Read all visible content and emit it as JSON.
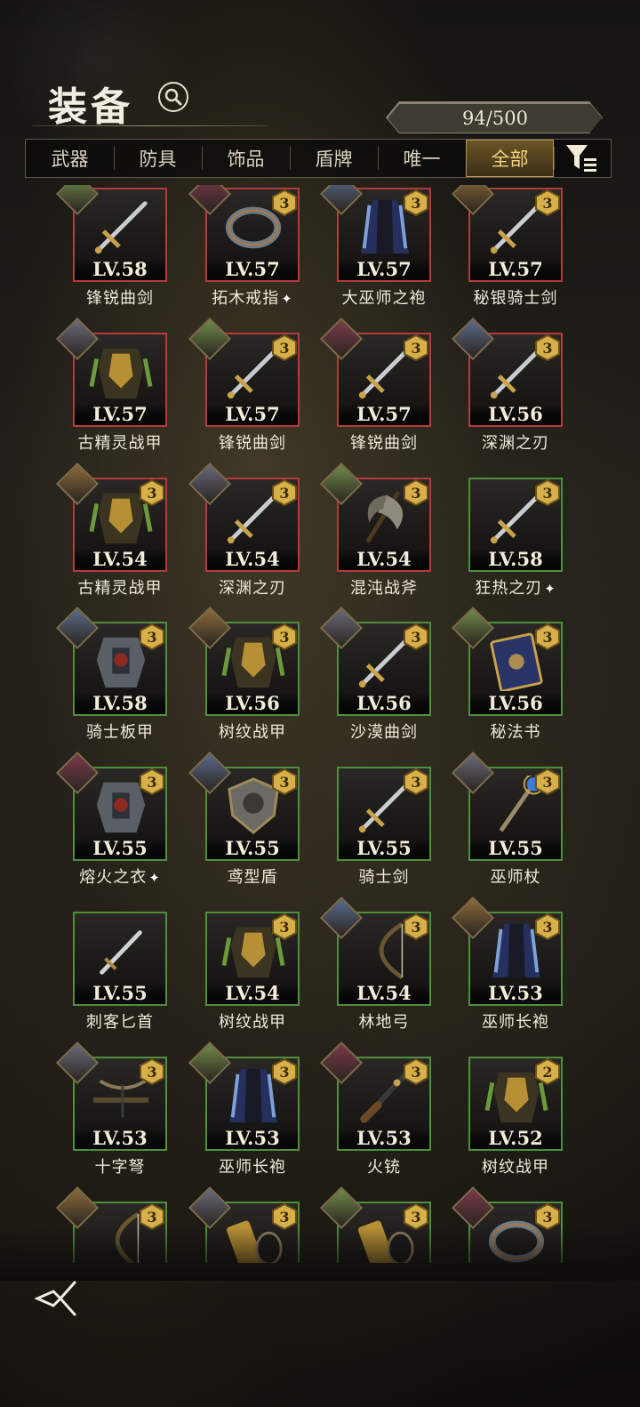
{
  "header": {
    "title": "装备",
    "capacity": "94/500"
  },
  "icons": {
    "search": "search-icon",
    "filter": "filter-icon",
    "back": "back-icon",
    "new_item": "sparkle-icon"
  },
  "tabs": [
    {
      "label": "武器",
      "active": false
    },
    {
      "label": "防具",
      "active": false
    },
    {
      "label": "饰品",
      "active": false
    },
    {
      "label": "盾牌",
      "active": false
    },
    {
      "label": "唯一",
      "active": false
    },
    {
      "label": "全部",
      "active": true
    }
  ],
  "items": [
    {
      "name": "锋锐曲剑",
      "level": "LV.58",
      "rarity": "red",
      "badge": "",
      "has_portrait": true,
      "new": false,
      "art": "sword"
    },
    {
      "name": "拓木戒指",
      "level": "LV.57",
      "rarity": "red",
      "badge": "3",
      "has_portrait": true,
      "new": true,
      "art": "ring"
    },
    {
      "name": "大巫师之袍",
      "level": "LV.57",
      "rarity": "red",
      "badge": "3",
      "has_portrait": true,
      "new": false,
      "art": "robe"
    },
    {
      "name": "秘银骑士剑",
      "level": "LV.57",
      "rarity": "red",
      "badge": "3",
      "has_portrait": true,
      "new": false,
      "art": "sword"
    },
    {
      "name": "古精灵战甲",
      "level": "LV.57",
      "rarity": "red",
      "badge": "",
      "has_portrait": true,
      "new": false,
      "art": "armor"
    },
    {
      "name": "锋锐曲剑",
      "level": "LV.57",
      "rarity": "red",
      "badge": "3",
      "has_portrait": true,
      "new": false,
      "art": "sword"
    },
    {
      "name": "锋锐曲剑",
      "level": "LV.57",
      "rarity": "red",
      "badge": "3",
      "has_portrait": true,
      "new": false,
      "art": "sword"
    },
    {
      "name": "深渊之刃",
      "level": "LV.56",
      "rarity": "red",
      "badge": "3",
      "has_portrait": true,
      "new": false,
      "art": "sword"
    },
    {
      "name": "古精灵战甲",
      "level": "LV.54",
      "rarity": "red",
      "badge": "3",
      "has_portrait": true,
      "new": false,
      "art": "armor"
    },
    {
      "name": "深渊之刃",
      "level": "LV.54",
      "rarity": "red",
      "badge": "3",
      "has_portrait": true,
      "new": false,
      "art": "sword"
    },
    {
      "name": "混沌战斧",
      "level": "LV.54",
      "rarity": "red",
      "badge": "3",
      "has_portrait": true,
      "new": false,
      "art": "axe"
    },
    {
      "name": "狂热之刃",
      "level": "LV.58",
      "rarity": "green",
      "badge": "3",
      "has_portrait": false,
      "new": true,
      "art": "sword"
    },
    {
      "name": "骑士板甲",
      "level": "LV.58",
      "rarity": "green",
      "badge": "3",
      "has_portrait": true,
      "new": false,
      "art": "plate"
    },
    {
      "name": "树纹战甲",
      "level": "LV.56",
      "rarity": "green",
      "badge": "3",
      "has_portrait": true,
      "new": false,
      "art": "armor"
    },
    {
      "name": "沙漠曲剑",
      "level": "LV.56",
      "rarity": "green",
      "badge": "3",
      "has_portrait": true,
      "new": false,
      "art": "sword"
    },
    {
      "name": "秘法书",
      "level": "LV.56",
      "rarity": "green",
      "badge": "3",
      "has_portrait": true,
      "new": false,
      "art": "book"
    },
    {
      "name": "熔火之衣",
      "level": "LV.55",
      "rarity": "green",
      "badge": "3",
      "has_portrait": true,
      "new": true,
      "art": "plate"
    },
    {
      "name": "鸢型盾",
      "level": "LV.55",
      "rarity": "green",
      "badge": "3",
      "has_portrait": true,
      "new": false,
      "art": "shield"
    },
    {
      "name": "骑士剑",
      "level": "LV.55",
      "rarity": "green",
      "badge": "3",
      "has_portrait": false,
      "new": false,
      "art": "sword"
    },
    {
      "name": "巫师杖",
      "level": "LV.55",
      "rarity": "green",
      "badge": "3",
      "has_portrait": true,
      "new": false,
      "art": "staff"
    },
    {
      "name": "刺客匕首",
      "level": "LV.55",
      "rarity": "green",
      "badge": "",
      "has_portrait": false,
      "new": false,
      "art": "dagger"
    },
    {
      "name": "树纹战甲",
      "level": "LV.54",
      "rarity": "green",
      "badge": "3",
      "has_portrait": false,
      "new": false,
      "art": "armor"
    },
    {
      "name": "林地弓",
      "level": "LV.54",
      "rarity": "green",
      "badge": "3",
      "has_portrait": true,
      "new": false,
      "art": "bow"
    },
    {
      "name": "巫师长袍",
      "level": "LV.53",
      "rarity": "green",
      "badge": "3",
      "has_portrait": true,
      "new": false,
      "art": "robe"
    },
    {
      "name": "十字弩",
      "level": "LV.53",
      "rarity": "green",
      "badge": "3",
      "has_portrait": true,
      "new": false,
      "art": "crossbow"
    },
    {
      "name": "巫师长袍",
      "level": "LV.53",
      "rarity": "green",
      "badge": "3",
      "has_portrait": true,
      "new": false,
      "art": "robe"
    },
    {
      "name": "火铳",
      "level": "LV.53",
      "rarity": "green",
      "badge": "3",
      "has_portrait": true,
      "new": false,
      "art": "gun"
    },
    {
      "name": "树纹战甲",
      "level": "LV.52",
      "rarity": "green",
      "badge": "2",
      "has_portrait": false,
      "new": false,
      "art": "armor"
    },
    {
      "name": "",
      "level": "",
      "rarity": "green",
      "badge": "3",
      "has_portrait": true,
      "new": false,
      "art": "bow"
    },
    {
      "name": "",
      "level": "",
      "rarity": "green",
      "badge": "3",
      "has_portrait": true,
      "new": false,
      "art": "bracer"
    },
    {
      "name": "",
      "level": "",
      "rarity": "green",
      "badge": "3",
      "has_portrait": true,
      "new": false,
      "art": "bracer"
    },
    {
      "name": "",
      "level": "",
      "rarity": "green",
      "badge": "3",
      "has_portrait": true,
      "new": false,
      "art": "ring"
    }
  ]
}
